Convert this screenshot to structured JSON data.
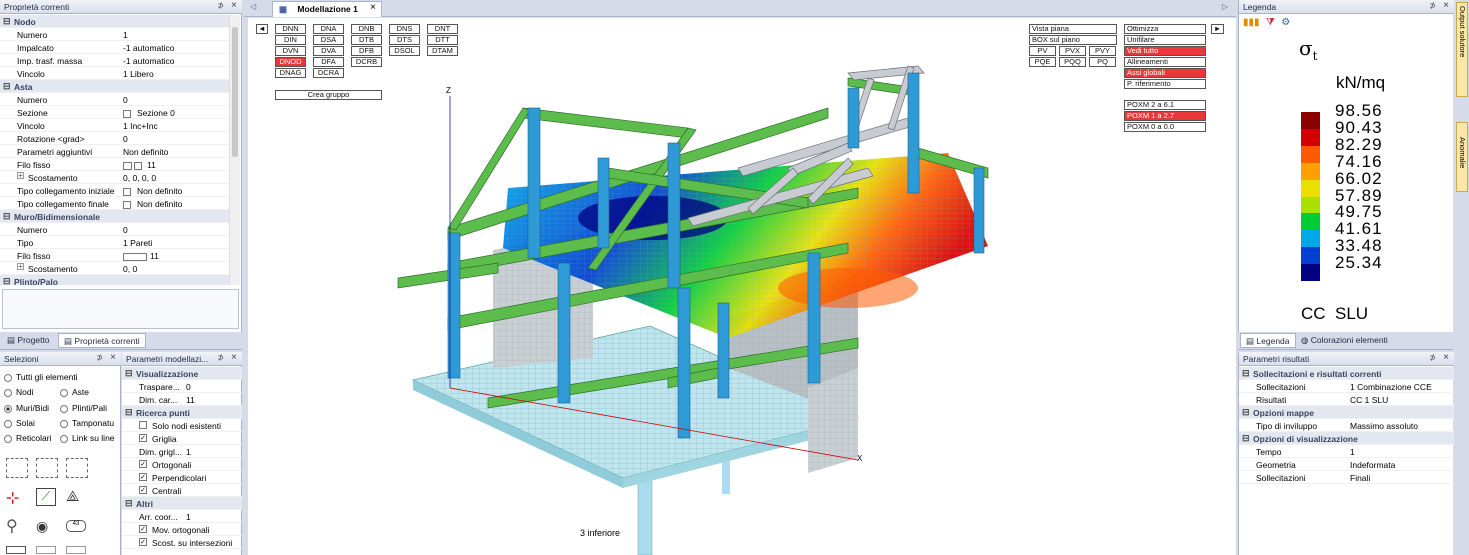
{
  "left_panel": {
    "title": "Proprietà correnti",
    "groups": [
      {
        "label": "Nodo",
        "rows": [
          [
            "Numero",
            "1"
          ],
          [
            "Impalcato",
            "-1 automatico"
          ],
          [
            "Imp. trasf. massa",
            "-1 automatico"
          ],
          [
            "Vincolo",
            "1 Libero"
          ]
        ]
      },
      {
        "label": "Asta",
        "rows": [
          [
            "Numero",
            "0"
          ],
          [
            "Sezione",
            "Sezione 0"
          ],
          [
            "Vincolo",
            "1 Inc+Inc"
          ],
          [
            "Rotazione <grad>",
            "0"
          ],
          [
            "Parametri aggiuntivi",
            "Non definito"
          ],
          [
            "Filo fisso",
            "11"
          ],
          [
            "Scostamento",
            "0, 0, 0, 0"
          ],
          [
            "Tipo collegamento iniziale",
            "Non definito"
          ],
          [
            "Tipo collegamento finale",
            "Non definito"
          ]
        ]
      },
      {
        "label": "Muro/Bidimensionale",
        "rows": [
          [
            "Numero",
            "0"
          ],
          [
            "Tipo",
            "1 Pareti"
          ],
          [
            "Filo fisso",
            "11"
          ],
          [
            "Scostamento",
            "0, 0"
          ]
        ]
      },
      {
        "label": "Plinto/Palo",
        "rows": []
      }
    ],
    "tabs": [
      "Progetto",
      "Proprietà correnti"
    ]
  },
  "selezioni": {
    "title": "Selezioni",
    "options": [
      "Tutti gli elementi",
      "Nodi",
      "Aste",
      "Muri/Bidi",
      "Plinti/Pali",
      "Solai",
      "Tamponatu",
      "Reticolari",
      "Link su line"
    ],
    "selected": "Muri/Bidi"
  },
  "parametri_modellazione": {
    "title": "Parametri modellazi...",
    "sections": [
      {
        "label": "Visualizzazione",
        "rows": [
          {
            "k": "Traspare...",
            "v": "0"
          },
          {
            "k": "Dim. car...",
            "v": "11"
          }
        ]
      },
      {
        "label": "Ricerca punti",
        "rows": [
          {
            "k": "Solo nodi esistenti",
            "cb": false
          },
          {
            "k": "Griglia",
            "cb": true
          },
          {
            "k": "Dim. grigl...",
            "v": "1"
          },
          {
            "k": "Ortogonali",
            "cb": true
          },
          {
            "k": "Perpendicolari",
            "cb": true
          },
          {
            "k": "Centrali",
            "cb": true
          }
        ]
      },
      {
        "label": "Altri",
        "rows": [
          {
            "k": "Arr. coor...",
            "v": "1"
          },
          {
            "k": "Mov. ortogonali",
            "cb": true
          },
          {
            "k": "Scost. su intersezioni",
            "cb": true
          }
        ]
      }
    ]
  },
  "document_tab": {
    "label": "Modellazione 1",
    "close": "×"
  },
  "toolbar_left": {
    "arrow": "◄",
    "rows": [
      [
        "DNN",
        "DNA",
        "DNB",
        "DNS",
        "DNT"
      ],
      [
        "DIN",
        "DSA",
        "DTB",
        "DTS",
        "DTT"
      ],
      [
        "DVN",
        "DVA",
        "DFB",
        "DSOL",
        "DTAM"
      ],
      [
        "DNOD",
        "DFA",
        "DCRB"
      ],
      [
        "DNAG",
        "DCRA"
      ]
    ],
    "red": [
      "DNOD"
    ],
    "group_button": "Crea gruppo"
  },
  "toolbar_right": {
    "vista_piana": "Vista piana",
    "box_piano": "BOX sul piano",
    "pv_buttons": [
      "PV",
      "PVX",
      "PVY"
    ],
    "pq_buttons": [
      "PQE",
      "PQQ",
      "PQ"
    ],
    "options": [
      "Ottimizza",
      "Unifilare",
      "Vedi tutto",
      "Allineamenti",
      "Assi globali",
      "P. riferimento"
    ],
    "red_options": [
      "Vedi tutto",
      "Assi globali"
    ],
    "poxm": [
      "POXM 2 a 6.1",
      "POXM 1 a 2.7",
      "POXM 0 a 0.0"
    ],
    "red_poxm": [
      "POXM 1 a 2.7"
    ],
    "arrow": "►"
  },
  "viewport": {
    "axis_z": "Z",
    "axis_x": "X",
    "view_label": "3 inferiore"
  },
  "legend_panel": {
    "title": "Legenda",
    "symbol": "σ",
    "symbol_sub": "t",
    "unit": "kN/mq",
    "values": [
      "98.56",
      "90.43",
      "82.29",
      "74.16",
      "66.02",
      "57.89",
      "49.75",
      "41.61",
      "33.48",
      "25.34"
    ],
    "colors": [
      "#8b0000",
      "#d40000",
      "#ff5a00",
      "#ffa000",
      "#e8e000",
      "#a8e000",
      "#00cc33",
      "#00a8e8",
      "#0040d0",
      "#000080"
    ],
    "footer": "CC  SLU",
    "tabs": [
      "Legenda",
      "Colorazioni elementi"
    ]
  },
  "side_tabs": [
    "Output solutore",
    "Anomalie"
  ],
  "risultati": {
    "title": "Parametri risultati",
    "sections": [
      {
        "label": "Sollecitazioni e risultati correnti",
        "rows": [
          [
            "Sollecitazioni",
            "1 Combinazione CCE"
          ],
          [
            "Risultati",
            "CC 1 SLU"
          ]
        ]
      },
      {
        "label": "Opzioni mappe",
        "rows": [
          [
            "Tipo di inviluppo",
            "Massimo assoluto"
          ]
        ]
      },
      {
        "label": "Opzioni di visualizzazione",
        "rows": [
          [
            "Tempo",
            "1"
          ],
          [
            "Geometria",
            "Indeformata"
          ],
          [
            "Sollecitazioni",
            "Finali"
          ]
        ]
      }
    ]
  }
}
